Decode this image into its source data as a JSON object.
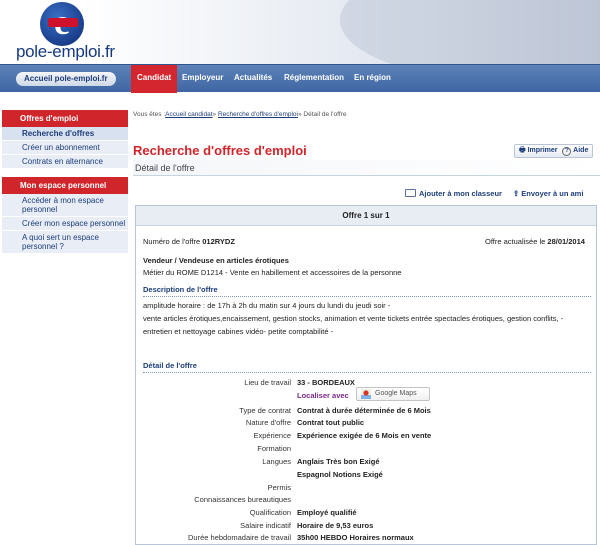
{
  "header": {
    "logo_letter": "e",
    "logo_text": "pole-emploi.fr"
  },
  "nav": {
    "home_label": "Accueil pole-emploi.fr",
    "tabs": [
      {
        "label": "Candidat"
      },
      {
        "label": "Employeur"
      },
      {
        "label": "Actualités"
      },
      {
        "label": "Réglementation"
      },
      {
        "label": "En région"
      }
    ]
  },
  "sidebar": {
    "section1_title": "Offres d'emploi",
    "section1_items": [
      {
        "label": "Recherche d'offres"
      },
      {
        "label": "Créer un abonnement"
      },
      {
        "label": "Contrats en alternance"
      }
    ],
    "section2_title": "Mon espace personnel",
    "section2_items": [
      {
        "label": "Accéder à mon espace personnel"
      },
      {
        "label": "Créer mon espace personnel"
      },
      {
        "label": "A quoi sert un espace personnel ?"
      }
    ]
  },
  "breadcrumb": {
    "prefix": "Vous êtes :",
    "link1": "Accueil candidat",
    "sep": "» ",
    "link2": "Recherche d'offres d'emploi",
    "current": "Détail de l'offre"
  },
  "page": {
    "title": "Recherche d'offres d'emploi",
    "subtitle": "Détail de l'offre",
    "print_label": "Imprimer",
    "help_label": "Aide",
    "add_label": "Ajouter à mon classeur",
    "send_label": "Envoyer à un ami"
  },
  "offer": {
    "counter": "Offre 1 sur 1",
    "number_label": "Numéro de l'offre",
    "number": "012RYDZ",
    "updated_label": "Offre actualisée le",
    "updated": "28/01/2014",
    "job_title": "Vendeur / Vendeuse en articles érotiques",
    "rome": "Métier du ROME D1214 - Vente en habillement et accessoires de la personne",
    "description_title": "Description de l'offre",
    "description_lines": [
      "amplitude horaire : de 17h à 2h du matin sur 4 jours du lundi du jeudi soir -",
      "vente articles érotiques,encaissement, gestion stocks, animation et vente tickets entrée spectacles érotiques, gestion conflits, -",
      "entretien et nettoyage cabines vidéo- petite comptabilité -"
    ],
    "detail_title": "Détail de l'offre",
    "localiser_label": "Localiser avec",
    "maps_label": "Google Maps",
    "details": [
      {
        "label": "Lieu de travail",
        "value": "33 - BORDEAUX"
      },
      {
        "label": "Type de contrat",
        "value": "Contrat à durée déterminée de 6 Mois"
      },
      {
        "label": "Nature d'offre",
        "value": "Contrat tout public"
      },
      {
        "label": "Expérience",
        "value": "Expérience exigée de 6 Mois en vente"
      },
      {
        "label": "Formation",
        "value": ""
      },
      {
        "label": "Langues",
        "value": "Anglais Très bon Exigé"
      },
      {
        "label": "",
        "value": "Espagnol Notions Exigé"
      },
      {
        "label": "Permis",
        "value": ""
      },
      {
        "label": "Connaissances bureautiques",
        "value": ""
      },
      {
        "label": "Qualification",
        "value": "Employé qualifié"
      },
      {
        "label": "Salaire indicatif",
        "value": "Horaire de 9,53 euros"
      },
      {
        "label": "Durée hebdomadaire de travail",
        "value": "35h00 HEBDO Horaires normaux"
      }
    ]
  }
}
